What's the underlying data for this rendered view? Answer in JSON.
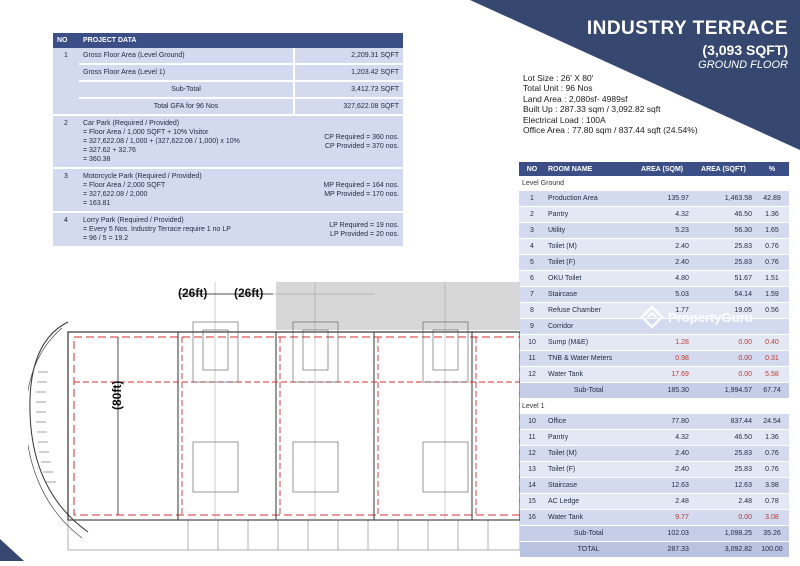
{
  "header": {
    "title": "INDUSTRY TERRACE",
    "size": "(3,093 SQFT)",
    "floor": "GROUND FLOOR"
  },
  "colors": {
    "navy": "#3b4f86",
    "row": "#d3d9ee",
    "red": "#c0392b"
  },
  "project_data": {
    "col_no": "NO",
    "col_title": "PROJECT DATA",
    "item1": {
      "no": "1",
      "gfa_ground_label": "Gross Floor Area (Level Ground)",
      "gfa_ground_value": "2,209.31 SQFT",
      "gfa_l1_label": "Gross Floor Area (Level 1)",
      "gfa_l1_value": "1,203.42 SQFT",
      "subtotal_label": "Sub-Total",
      "subtotal_value": "3,412.73 SQFT",
      "total_label": "Total GFA for 96 Nos",
      "total_value": "327,622.08 SQFT"
    },
    "item2": {
      "no": "2",
      "calc": "Car Park (Required / Provided)\n= Floor Area / 1,000 SQFT  + 10% Visitor\n= 327,622.08 / 1,000  + (327,622.08 / 1,000) x 10%\n= 327.62 + 32.76\n= 360.38",
      "result": "CP Required =  360 nos.\nCP Provided = 370 nos."
    },
    "item3": {
      "no": "3",
      "calc": "Motorcycle Park (Required / Provided)\n= Floor Area / 2,000 SQFT\n= 327,622.08 / 2,000\n= 163.81",
      "result": "MP Required = 164 nos.\nMP Provided = 170 nos."
    },
    "item4": {
      "no": "4",
      "calc": "Lorry Park (Required / Provided)\n= Every 5 Nos. Industry Terrace require 1 no LP\n= 96 / 5  =  19.2",
      "result": "LP Required = 19 nos.\nLP Provided = 20 nos."
    }
  },
  "specs": {
    "lot_size": "Lot Size    : 26' X 80'",
    "total_unit": "Total Unit  : 96 Nos",
    "land_area": "Land Area : 2,080sf- 4989sf",
    "built_up": "Built Up    : 287.33 sqm / 3,092.82 sqft",
    "electrical": "Electrical Load : 100A",
    "office_area": "Office Area : 77.80 sqm / 837.44 sqft (24.54%)"
  },
  "room_table": {
    "headers": {
      "no": "NO",
      "name": "ROOM NAME",
      "sqm": "AREA (SQM)",
      "sqft": "AREA (SQFT)",
      "pct": "%"
    },
    "ground_label": "Level Ground",
    "ground": [
      {
        "no": "1",
        "name": "Production Area",
        "sqm": "135.97",
        "sqft": "1,463.58",
        "pct": "42.89"
      },
      {
        "no": "2",
        "name": "Pantry",
        "sqm": "4.32",
        "sqft": "46.50",
        "pct": "1.36"
      },
      {
        "no": "3",
        "name": "Utility",
        "sqm": "5.23",
        "sqft": "56.30",
        "pct": "1.65"
      },
      {
        "no": "4",
        "name": "Toilet (M)",
        "sqm": "2.40",
        "sqft": "25.83",
        "pct": "0.76"
      },
      {
        "no": "5",
        "name": "Toilet (F)",
        "sqm": "2.40",
        "sqft": "25.83",
        "pct": "0.76"
      },
      {
        "no": "6",
        "name": "OKU Toilet",
        "sqm": "4.80",
        "sqft": "51.67",
        "pct": "1.51"
      },
      {
        "no": "7",
        "name": "Staircase",
        "sqm": "5.03",
        "sqft": "54.14",
        "pct": "1.59"
      },
      {
        "no": "8",
        "name": "Refuse Chamber",
        "sqm": "1.77",
        "sqft": "19.05",
        "pct": "0.56"
      },
      {
        "no": "9",
        "name": "Corridor",
        "sqm": "",
        "sqft": "",
        "pct": ""
      },
      {
        "no": "10",
        "name": "Sump (M&E)",
        "sqm": "1.28",
        "sqft": "0.00",
        "pct": "0.40"
      },
      {
        "no": "11",
        "name": "TNB & Water Meters",
        "sqm": "0.98",
        "sqft": "0.00",
        "pct": "0.31"
      },
      {
        "no": "12",
        "name": "Water Tank",
        "sqm": "17.69",
        "sqft": "0.00",
        "pct": "5.58"
      }
    ],
    "ground_subtotal": {
      "label": "Sub-Total",
      "sqm": "185.30",
      "sqft": "1,994.57",
      "pct": "67.74"
    },
    "level1_label": "Level 1",
    "level1": [
      {
        "no": "10",
        "name": "Office",
        "sqm": "77.80",
        "sqft": "837.44",
        "pct": "24.54"
      },
      {
        "no": "11",
        "name": "Pantry",
        "sqm": "4.32",
        "sqft": "46.50",
        "pct": "1.36"
      },
      {
        "no": "12",
        "name": "Toilet (M)",
        "sqm": "2.40",
        "sqft": "25.83",
        "pct": "0.76"
      },
      {
        "no": "13",
        "name": "Toilet (F)",
        "sqm": "2.40",
        "sqft": "25.83",
        "pct": "0.76"
      },
      {
        "no": "14",
        "name": "Staircase",
        "sqm": "12.63",
        "sqft": "12.63",
        "pct": "3.98"
      },
      {
        "no": "15",
        "name": "AC Ledge",
        "sqm": "2.48",
        "sqft": "2.48",
        "pct": "0.78"
      },
      {
        "no": "16",
        "name": "Water Tank",
        "sqm": "9.77",
        "sqft": "0.00",
        "pct": "3.08"
      }
    ],
    "level1_subtotal": {
      "label": "Sub-Total",
      "sqm": "102.03",
      "sqft": "1,098.25",
      "pct": "35.26"
    },
    "total": {
      "label": "TOTAL",
      "sqm": "287.33",
      "sqft": "3,092.82",
      "pct": "100.00"
    }
  },
  "plan": {
    "dim_width_a": "(26ft)",
    "dim_width_b": "(26ft)",
    "dim_depth": "(80ft)"
  },
  "watermark": {
    "brand": "PropertyGuru",
    "icon": "propertyguru-logo-icon"
  }
}
